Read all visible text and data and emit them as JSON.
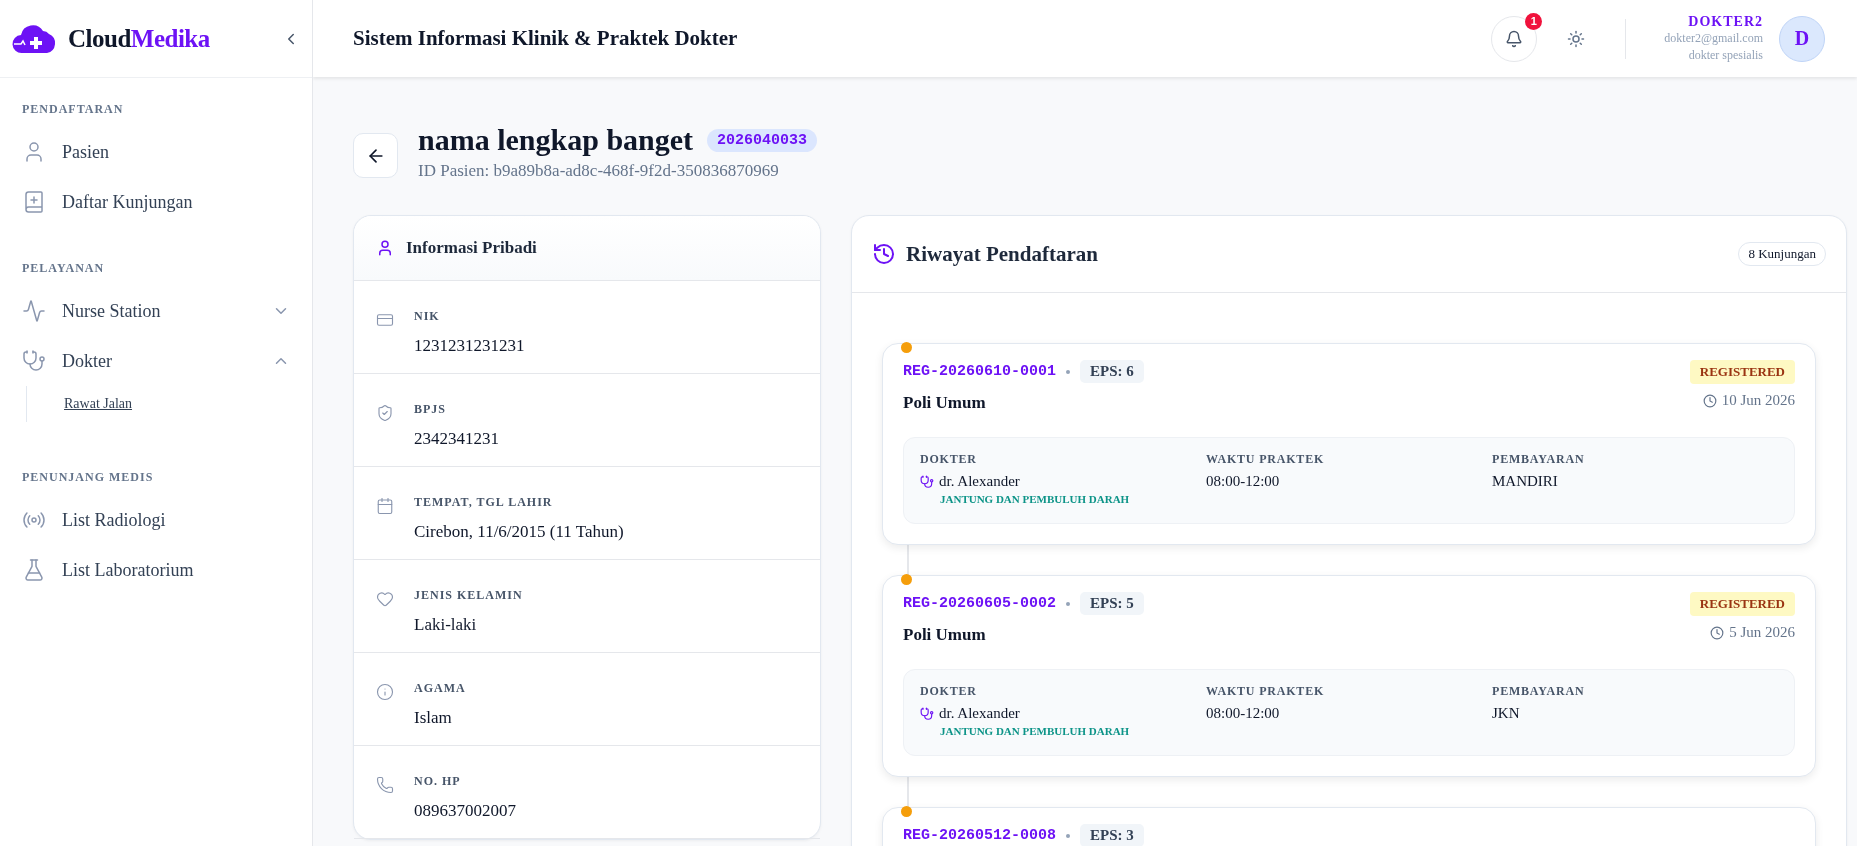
{
  "sidebar": {
    "brand": {
      "first": "Cloud",
      "second": "Medika"
    },
    "sections": [
      {
        "title": "PENDAFTARAN",
        "items": [
          {
            "label": "Pasien",
            "selected": false
          },
          {
            "label": "Daftar Kunjungan",
            "selected": false
          }
        ]
      },
      {
        "title": "PELAYANAN",
        "items": [
          {
            "label": "Nurse Station",
            "selected": false,
            "expanded": false
          },
          {
            "label": "Dokter",
            "selected": false,
            "expanded": true,
            "children": [
              {
                "label": "Rawat Jalan",
                "selected": true
              }
            ]
          }
        ]
      },
      {
        "title": "PENUNJANG MEDIS",
        "items": [
          {
            "label": "List Radiologi",
            "selected": false
          },
          {
            "label": "List Laboratorium",
            "selected": false
          }
        ]
      }
    ]
  },
  "header": {
    "title": "Sistem Informasi Klinik & Praktek Dokter",
    "notification_count": "1",
    "user": {
      "name": "DOKTER2",
      "email": "dokter2@gmail.com",
      "role": "dokter spesialis",
      "initial": "D"
    }
  },
  "patient": {
    "name": "nama lengkap banget",
    "mrn": "2026040033",
    "id_line": "ID Pasien: b9a89b8a-ad8c-468f-9f2d-350836870969"
  },
  "personal_info": {
    "title": "Informasi Pribadi",
    "fields": [
      {
        "label": "NIK",
        "value": "1231231231231"
      },
      {
        "label": "BPJS",
        "value": "2342341231"
      },
      {
        "label": "TEMPAT, TGL LAHIR",
        "value": "Cirebon, 11/6/2015 (11 Tahun)"
      },
      {
        "label": "JENIS KELAMIN",
        "value": "Laki-laki"
      },
      {
        "label": "AGAMA",
        "value": "Islam"
      },
      {
        "label": "NO. HP",
        "value": "089637002007"
      }
    ]
  },
  "history": {
    "title": "Riwayat Pendaftaran",
    "count": "8 Kunjungan",
    "visits": [
      {
        "reg": "REG-20260610-0001",
        "eps": "EPS: 6",
        "poli": "Poli Umum",
        "status": "REGISTERED",
        "date": "10 Jun 2026",
        "details": [
          {
            "label": "DOKTER",
            "value": "dr. Alexander",
            "note": "JANTUNG DAN PEMBULUH DARAH"
          },
          {
            "label": "WAKTU PRAKTEK",
            "value": "08:00-12:00"
          },
          {
            "label": "PEMBAYARAN",
            "value": "MANDIRI"
          }
        ]
      },
      {
        "reg": "REG-20260605-0002",
        "eps": "EPS: 5",
        "poli": "Poli Umum",
        "status": "REGISTERED",
        "date": "5 Jun 2026",
        "details": [
          {
            "label": "DOKTER",
            "value": "dr. Alexander",
            "note": "JANTUNG DAN PEMBULUH DARAH"
          },
          {
            "label": "WAKTU PRAKTEK",
            "value": "08:00-12:00"
          },
          {
            "label": "PEMBAYARAN",
            "value": "JKN"
          }
        ]
      },
      {
        "reg": "REG-20260512-0008",
        "eps": "EPS: 3"
      }
    ]
  }
}
